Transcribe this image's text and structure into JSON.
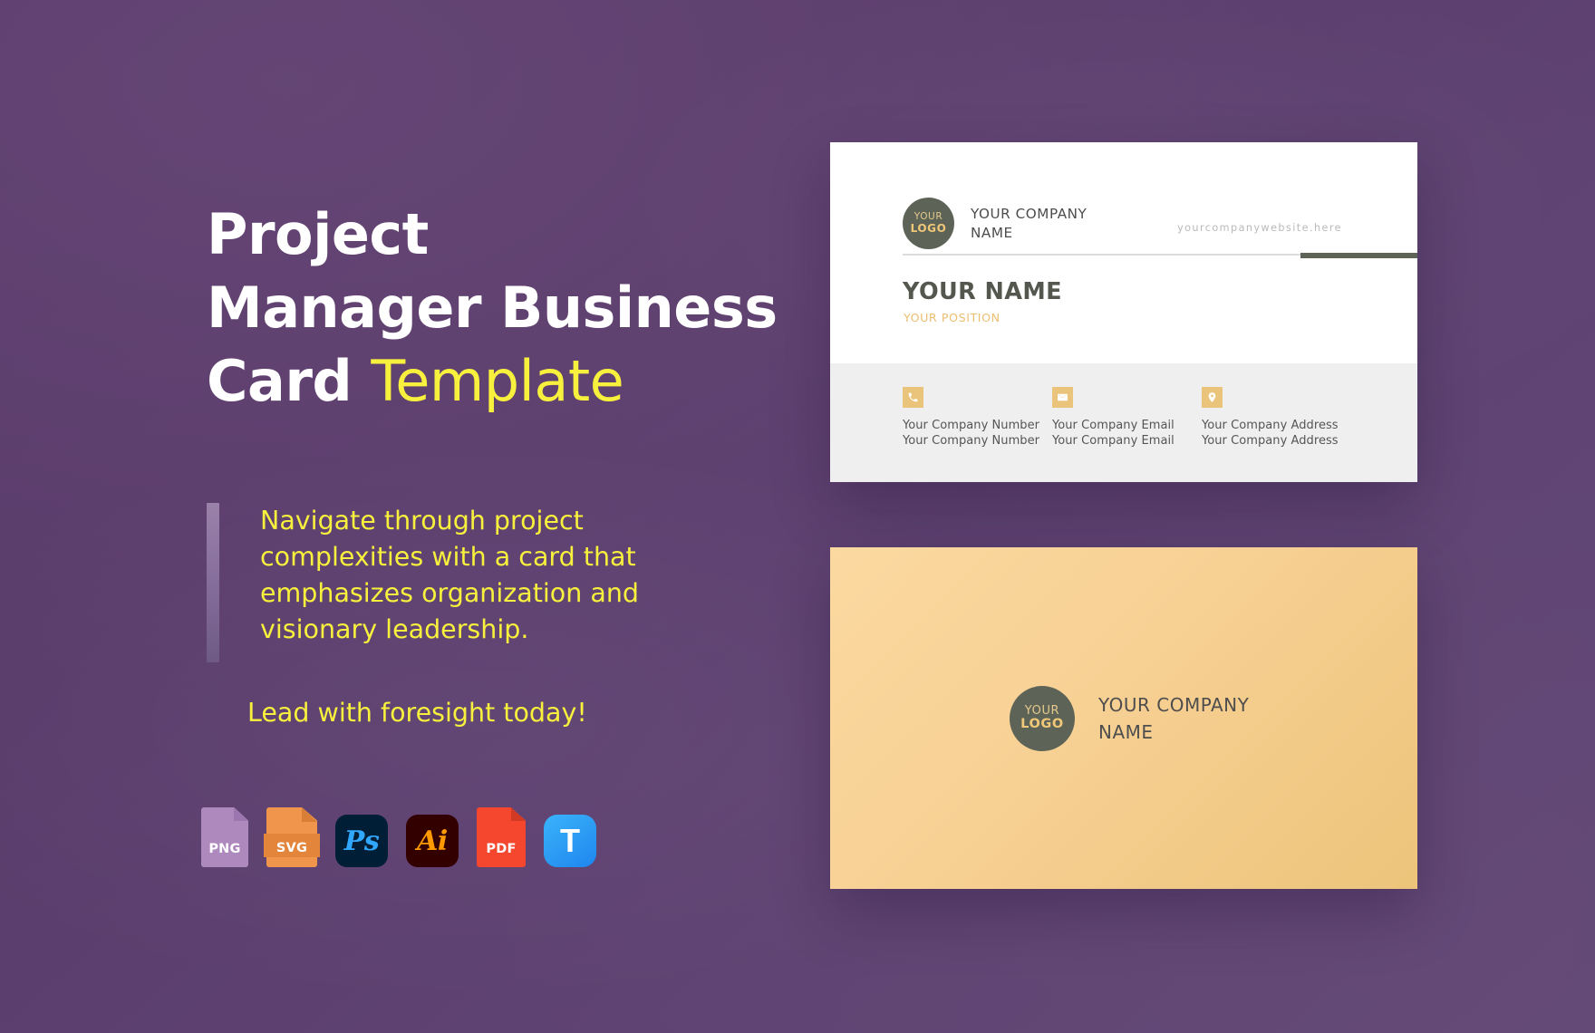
{
  "page": {
    "background_color": "#5B3E6C",
    "accent_yellow": "#F7F03C",
    "gold": "#EBC47B",
    "olive": "#5D6357"
  },
  "hero": {
    "headline_line1": "Project",
    "headline_line2": "Manager Business",
    "headline_line3_bold": "Card",
    "headline_line3_accent": "Template",
    "description": "Navigate through project complexities with a card that emphasizes organization and visionary leadership.",
    "cta": "Lead with foresight today!"
  },
  "formats": [
    {
      "id": "png",
      "label": "PNG",
      "kind": "document",
      "color": "#AE89BE"
    },
    {
      "id": "svg",
      "label": "SVG",
      "kind": "document",
      "color": "#F0964C"
    },
    {
      "id": "psd",
      "label": "Ps",
      "kind": "app",
      "color": "#001E36"
    },
    {
      "id": "ai",
      "label": "Ai",
      "kind": "app",
      "color": "#330000"
    },
    {
      "id": "pdf",
      "label": "PDF",
      "kind": "document",
      "color": "#F4472E"
    },
    {
      "id": "tpl",
      "label": "T",
      "kind": "app",
      "color": "#2E9CF4"
    }
  ],
  "card_front": {
    "logo": {
      "line1": "YOUR",
      "line2": "LOGO"
    },
    "company_name_line1": "YOUR COMPANY",
    "company_name_line2": "NAME",
    "website": "yourcompanywebsite.here",
    "person_name": "YOUR NAME",
    "person_position": "YOUR POSITION",
    "contacts": [
      {
        "icon": "phone-icon",
        "line1": "Your Company Number",
        "line2": "Your Company Number"
      },
      {
        "icon": "email-icon",
        "line1": "Your Company Email",
        "line2": "Your Company Email"
      },
      {
        "icon": "location-icon",
        "line1": "Your Company Address",
        "line2": "Your Company Address"
      }
    ]
  },
  "card_back": {
    "logo": {
      "line1": "YOUR",
      "line2": "LOGO"
    },
    "company_name_line1": "YOUR COMPANY",
    "company_name_line2": "NAME"
  }
}
